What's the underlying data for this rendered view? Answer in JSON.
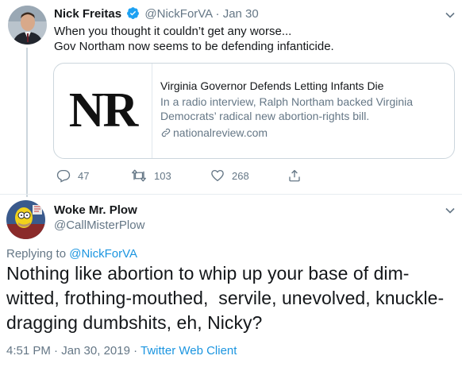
{
  "tweet1": {
    "name": "Nick Freitas",
    "handle": "@NickForVA",
    "dot": "·",
    "date": "Jan 30",
    "text_lines": [
      "When you thought it couldn’t get any worse...",
      "Gov Northam now seems to be defending infanticide."
    ],
    "card": {
      "logo_text": "NR",
      "title": "Virginia Governor Defends Letting Infants Die",
      "description_lines": [
        "In a radio interview, Ralph Northam backed Virginia",
        "Democrats’ radical new abortion-rights bill."
      ],
      "domain": "nationalreview.com"
    },
    "actions": {
      "replies": "47",
      "retweets": "103",
      "likes": "268"
    }
  },
  "tweet2": {
    "name": "Woke Mr. Plow",
    "handle": "@CallMisterPlow",
    "replying_prefix": "Replying to",
    "replying_to": "@NickForVA",
    "text_lines": [
      "Nothing like abortion to whip up your base of dim-",
      "witted, frothing-mouthed,  servile, unevolved, knuckle-",
      "dragging dumbshits, eh, Nicky?"
    ],
    "time": "4:51 PM · Jan 30, 2019 ·",
    "client": "Twitter Web Client"
  },
  "colors": {
    "accent": "#1b95e0",
    "muted": "#657786",
    "border": "#ccd6dd"
  },
  "icons": [
    "verified-badge-icon",
    "chevron-down-icon",
    "reply-icon",
    "retweet-icon",
    "like-icon",
    "share-icon",
    "link-icon"
  ]
}
